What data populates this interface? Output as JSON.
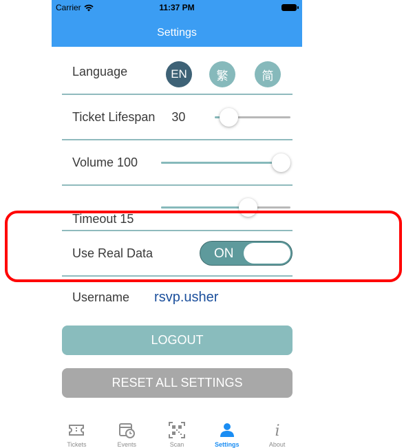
{
  "status_bar": {
    "carrier": "Carrier",
    "time": "11:37 PM"
  },
  "nav": {
    "title": "Settings"
  },
  "language": {
    "label": "Language",
    "options": [
      "EN",
      "繁",
      "简"
    ],
    "selected": "EN"
  },
  "ticket_lifespan": {
    "label": "Ticket Lifespan",
    "value": "30",
    "level": 0.08
  },
  "volume": {
    "label": "Volume 100",
    "level": 1.0
  },
  "timeout": {
    "label": "Timeout 15",
    "level": 0.7
  },
  "real_data": {
    "label": "Use Real Data",
    "toggle_text": "ON",
    "state": "on"
  },
  "username": {
    "label": "Username",
    "value": "rsvp.usher"
  },
  "buttons": {
    "logout": "LOGOUT",
    "reset": "RESET ALL SETTINGS"
  },
  "tabs": [
    {
      "label": "Tickets",
      "icon": "ticket-icon"
    },
    {
      "label": "Events",
      "icon": "calendar-clock-icon"
    },
    {
      "label": "Scan",
      "icon": "qr-code-icon"
    },
    {
      "label": "Settings",
      "icon": "person-icon",
      "active": true
    },
    {
      "label": "About",
      "icon": "info-icon"
    }
  ],
  "colors": {
    "header_blue": "#3b9df3",
    "teal": "#86b9bb",
    "teal_dark": "#3e6276",
    "toggle_on": "#5e9a9c",
    "link_blue": "#1b4f9c",
    "tab_active": "#1a8df3",
    "highlight_red": "#ff0000"
  }
}
